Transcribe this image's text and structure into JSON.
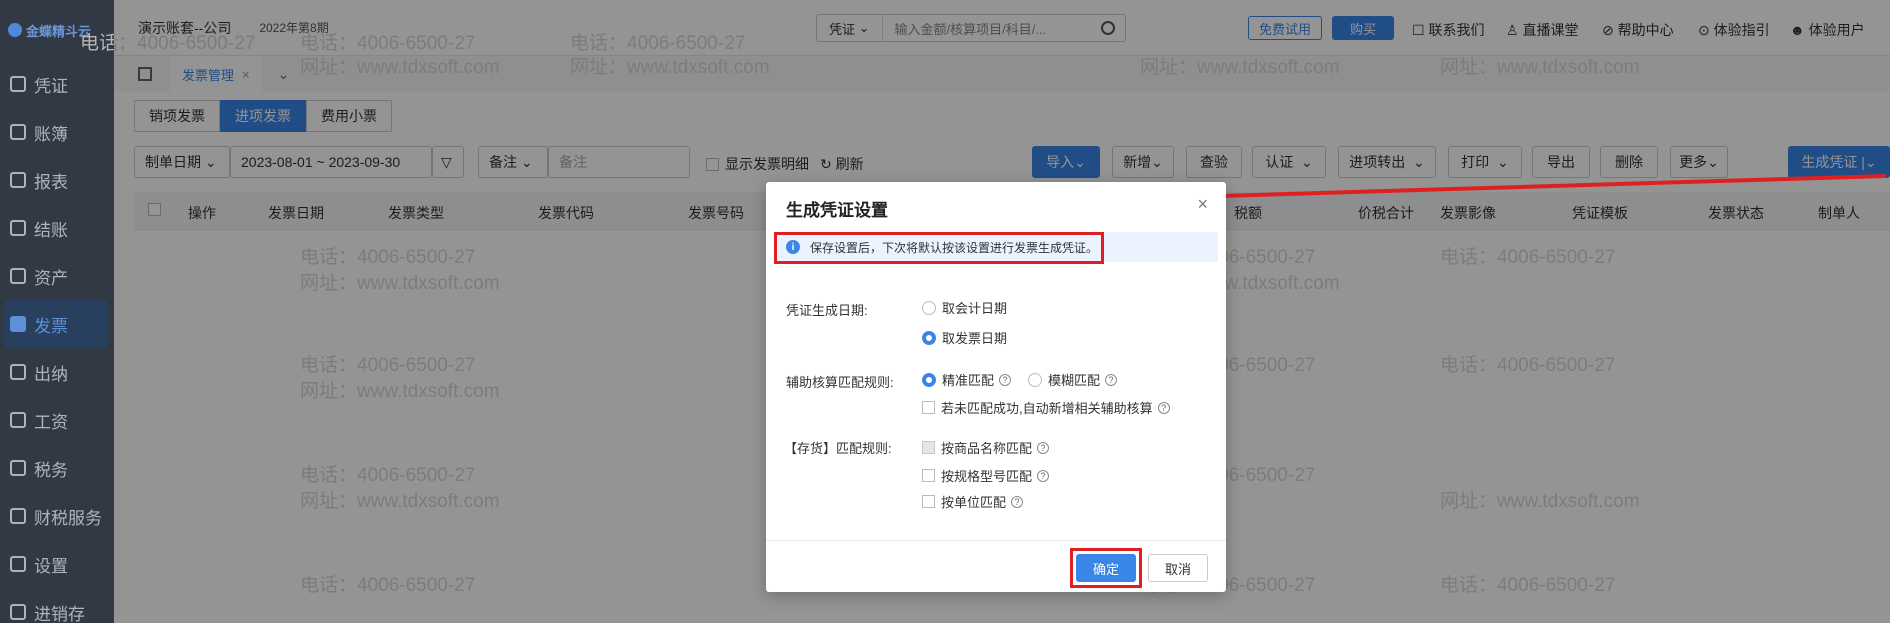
{
  "brand": "金蝶精斗云",
  "sidebar": {
    "items": [
      {
        "label": "凭证"
      },
      {
        "label": "账簿"
      },
      {
        "label": "报表"
      },
      {
        "label": "结账"
      },
      {
        "label": "资产"
      },
      {
        "label": "发票"
      },
      {
        "label": "出纳"
      },
      {
        "label": "工资"
      },
      {
        "label": "税务"
      },
      {
        "label": "财税服务"
      },
      {
        "label": "设置"
      },
      {
        "label": "进销存"
      }
    ],
    "active": "发票"
  },
  "header": {
    "account": "演示账套--公司",
    "period": "2022年第8期",
    "search_type": "凭证",
    "search_placeholder": "输入金额/核算项目/科目/...",
    "free_trial": "免费试用",
    "buy": "购买",
    "links": [
      "联系我们",
      "直播课堂",
      "帮助中心",
      "体验指引",
      "体验用户"
    ]
  },
  "page_tab": "发票管理",
  "subtabs": [
    "销项发票",
    "进项发票",
    "费用小票"
  ],
  "filters": {
    "date_type": "制单日期",
    "date_range": "2023-08-01 ~ 2023-09-30",
    "remark_select": "备注",
    "remark_placeholder": "备注",
    "show_detail": "显示发票明细",
    "refresh": "刷新"
  },
  "toolbar": [
    "导入",
    "新增",
    "查验",
    "认证",
    "进项转出",
    "打印",
    "导出",
    "删除",
    "更多",
    "生成凭证"
  ],
  "table": {
    "columns": [
      "操作",
      "发票日期",
      "发票类型",
      "发票代码",
      "发票号码",
      "税额",
      "价税合计",
      "发票影像",
      "凭证模板",
      "发票状态",
      "制单人"
    ]
  },
  "watermark": {
    "phone": "电话：4006-6500-27",
    "site": "网址：www.tdxsoft.com"
  },
  "dialog": {
    "title": "生成凭证设置",
    "notice": "保存设置后，下次将默认按该设置进行发票生成凭证。",
    "date_label": "凭证生成日期:",
    "date_options": [
      "取会计日期",
      "取发票日期"
    ],
    "aux_label": "辅助核算匹配规则:",
    "aux_options": [
      "精准匹配",
      "模糊匹配"
    ],
    "aux_auto_add": "若未匹配成功,自动新增相关辅助核算",
    "inv_label": "【存货】匹配规则:",
    "inv_options": [
      "按商品名称匹配",
      "按规格型号匹配",
      "按单位匹配"
    ],
    "ok": "确定",
    "cancel": "取消"
  },
  "colors": {
    "accent": "#3a86e8",
    "sidebar_bg": "#3a4351",
    "highlight_red": "#e02020"
  }
}
